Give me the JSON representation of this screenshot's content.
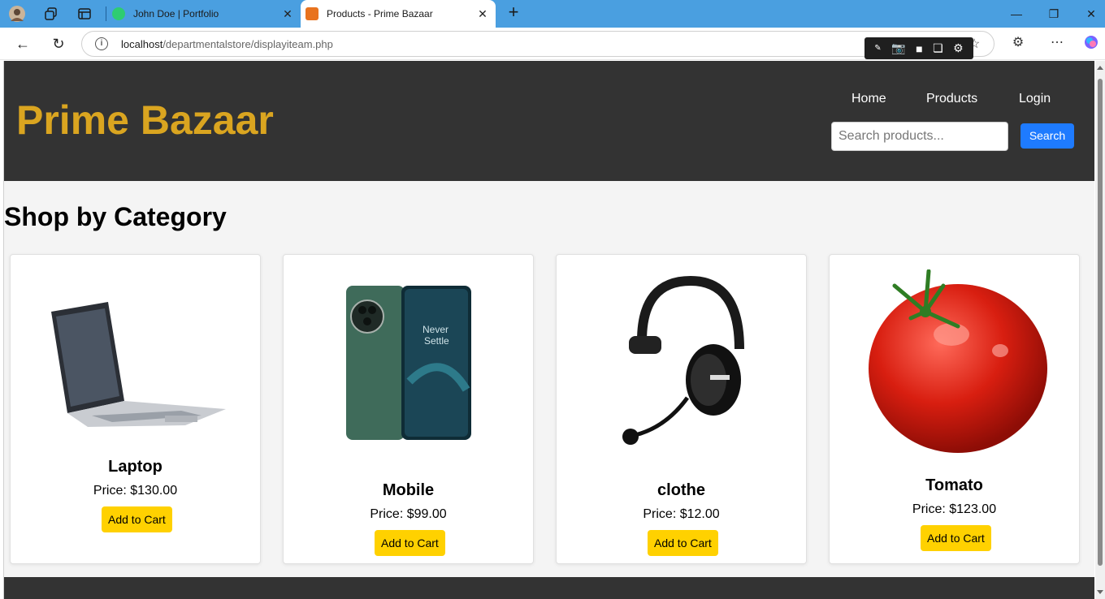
{
  "browser": {
    "tabs": [
      {
        "title": "John Doe | Portfolio",
        "close": "✕"
      },
      {
        "title": "Products - Prime Bazaar",
        "close": "✕"
      }
    ],
    "newtab": "+",
    "url_host": "localhost",
    "url_path": "/departmentalstore/displayiteam.php"
  },
  "header": {
    "brand": "Prime Bazaar",
    "nav": [
      "Home",
      "Products",
      "Login"
    ],
    "search_placeholder": "Search products...",
    "search_button": "Search"
  },
  "main": {
    "section_title": "Shop by Category",
    "products": [
      {
        "name": "Laptop",
        "price": "Price: $130.00",
        "button": "Add to Cart"
      },
      {
        "name": "Mobile",
        "price": "Price: $99.00",
        "button": "Add to Cart"
      },
      {
        "name": "clothe",
        "price": "Price: $12.00",
        "button": "Add to Cart"
      },
      {
        "name": "Tomato",
        "price": "Price: $123.00",
        "button": "Add to Cart"
      }
    ]
  },
  "colors": {
    "brand": "#daa520",
    "header_bg": "#333333",
    "search_button": "#1e7bff",
    "cart_button": "#ffd100",
    "tabbar": "#4a9fe0"
  }
}
